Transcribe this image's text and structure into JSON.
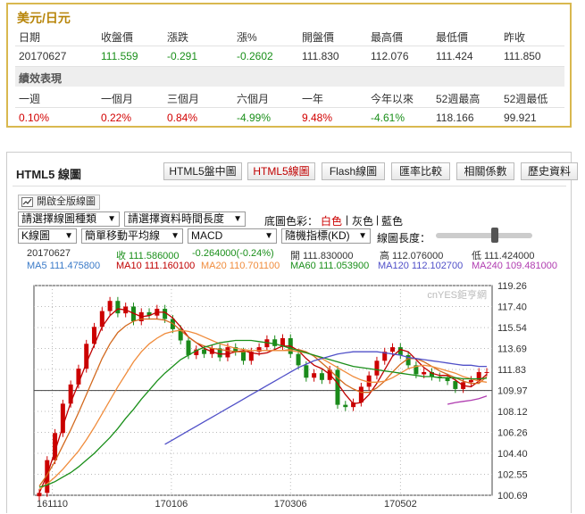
{
  "quote": {
    "title": "美元/日元",
    "headers": [
      "日期",
      "收盤價",
      "漲跌",
      "漲%",
      "開盤價",
      "最高價",
      "最低價",
      "昨收"
    ],
    "values": [
      "20170627",
      "111.559",
      "-0.291",
      "-0.2602",
      "111.830",
      "112.076",
      "111.424",
      "111.850"
    ],
    "perf_label": "績效表現",
    "perf_headers": [
      "一週",
      "一個月",
      "三個月",
      "六個月",
      "一年",
      "今年以來",
      "52週最高",
      "52週最低"
    ],
    "perf_values": [
      "0.10%",
      "0.22%",
      "0.84%",
      "-4.99%",
      "9.48%",
      "-4.61%",
      "118.166",
      "99.921"
    ]
  },
  "panel": {
    "title": "HTML5 線圖",
    "tabs": [
      "HTML5盤中圖",
      "HTML5線圖",
      "Flash線圖",
      "匯率比較",
      "相關係數",
      "歷史資料"
    ],
    "active_tab": "HTML5線圖",
    "full_version": "開啟全版線圖"
  },
  "controls": {
    "chart_type": "請選擇線圖種類",
    "time_length": "請選擇資料時間長度",
    "bg_label": "底圖色彩：",
    "bg_white": "白色",
    "bg_gray": "灰色",
    "bg_blue": "藍色",
    "divider": "|",
    "kline": "K線圖",
    "ma": "簡單移動平均線",
    "macd": "MACD",
    "kd": "隨機指標(KD)",
    "line_len": "線圖長度："
  },
  "info": {
    "date": "20170627",
    "close": "收 111.586000",
    "change": "-0.264000(-0.24%)",
    "open": "開 111.830000",
    "high": "高 112.076000",
    "low": "低 111.424000",
    "ma5": "MA5 111.475800",
    "ma10": "MA10 111.160100",
    "ma20": "MA20 110.701100",
    "ma60": "MA60 111.053900",
    "ma120": "MA120 112.102700",
    "ma240": "MA240 109.481000"
  },
  "colors": {
    "up": "#cc0000",
    "down": "#1a8a1a",
    "ma5": "#c00000",
    "ma10": "#d2691e",
    "ma20": "#f08c3c",
    "ma60": "#1a8f1a",
    "ma120": "#5050c8",
    "ma240": "#b03cb0"
  },
  "chart_data": {
    "type": "line",
    "y_ticks": [
      "119.26",
      "117.40",
      "115.54",
      "113.69",
      "111.83",
      "109.97",
      "108.12",
      "106.26",
      "104.40",
      "102.55",
      "100.69"
    ],
    "x_ticks": [
      "161110",
      "170106",
      "170306",
      "170502"
    ],
    "watermark": "cnYES鉅亨網",
    "series": [
      {
        "name": "MA5",
        "values": [
          100.9,
          102.5,
          104.6,
          106.8,
          108.9,
          110.6,
          112.4,
          114.0,
          115.6,
          116.6,
          117.2,
          117.1,
          116.8,
          116.5,
          116.6,
          116.9,
          116.9,
          116.4,
          115.6,
          114.7,
          114.2,
          113.7,
          113.4,
          113.2,
          113.2,
          113.4,
          113.5,
          113.3,
          113.2,
          113.3,
          113.6,
          113.9,
          113.9,
          113.5,
          112.8,
          112.2,
          111.9,
          111.4,
          110.6,
          109.6,
          108.8,
          108.9,
          109.6,
          110.6,
          111.8,
          113.0,
          113.6,
          113.4,
          112.7,
          112.0,
          111.5,
          111.3,
          111.3,
          110.9,
          110.4,
          110.3,
          110.8,
          111.4
        ]
      },
      {
        "name": "MA10",
        "values": [
          101.5,
          102.5,
          103.7,
          105.1,
          106.5,
          108.0,
          109.6,
          111.2,
          112.8,
          114.1,
          115.1,
          115.7,
          116.1,
          116.3,
          116.3,
          116.3,
          116.2,
          115.9,
          115.3,
          114.7,
          114.2,
          113.9,
          113.7,
          113.6,
          113.5,
          113.4,
          113.4,
          113.5,
          113.5,
          113.5,
          113.5,
          113.5,
          113.6,
          113.6,
          113.4,
          113.0,
          112.4,
          111.8,
          111.1,
          110.5,
          110.1,
          109.8,
          109.8,
          110.2,
          110.8,
          111.6,
          112.3,
          112.8,
          112.8,
          112.5,
          112.1,
          111.7,
          111.4,
          111.1,
          110.8,
          110.6,
          110.6,
          111.2
        ]
      },
      {
        "name": "MA20",
        "values": [
          101.2,
          101.7,
          102.3,
          103.0,
          103.8,
          104.6,
          105.6,
          106.7,
          107.9,
          109.1,
          110.3,
          111.4,
          112.5,
          113.4,
          114.1,
          114.6,
          115.0,
          115.2,
          115.3,
          115.2,
          115.0,
          114.7,
          114.4,
          114.1,
          113.9,
          113.7,
          113.6,
          113.5,
          113.5,
          113.5,
          113.5,
          113.5,
          113.5,
          113.4,
          113.3,
          113.1,
          112.8,
          112.4,
          112.0,
          111.6,
          111.2,
          110.9,
          110.7,
          110.7,
          110.8,
          111.1,
          111.5,
          111.9,
          112.1,
          112.2,
          112.1,
          111.9,
          111.7,
          111.5,
          111.2,
          111.0,
          110.8,
          110.7
        ]
      },
      {
        "name": "MA60",
        "values": [
          101.4,
          101.6,
          101.9,
          102.3,
          102.7,
          103.2,
          103.8,
          104.4,
          105.1,
          105.8,
          106.6,
          107.5,
          108.3,
          109.2,
          110.0,
          110.8,
          111.5,
          112.1,
          112.7,
          113.1,
          113.5,
          113.8,
          114.0,
          114.2,
          114.3,
          114.4,
          114.4,
          114.4,
          114.3,
          114.2,
          114.1,
          113.9,
          113.7,
          113.5,
          113.3,
          113.1,
          112.9,
          112.7,
          112.5,
          112.3,
          112.1,
          112.0,
          111.9,
          111.8,
          111.7,
          111.6,
          111.5,
          111.4,
          111.3,
          111.2,
          111.2,
          111.1,
          111.1,
          111.1,
          111.0,
          111.0,
          111.0,
          111.05
        ]
      },
      {
        "name": "MA120",
        "values": [
          null,
          null,
          null,
          null,
          null,
          null,
          null,
          null,
          null,
          null,
          null,
          null,
          null,
          null,
          null,
          null,
          105.2,
          105.6,
          106.0,
          106.4,
          106.8,
          107.2,
          107.6,
          108.0,
          108.4,
          108.8,
          109.2,
          109.6,
          110.0,
          110.4,
          110.8,
          111.2,
          111.6,
          112.0,
          112.3,
          112.6,
          112.8,
          113.0,
          113.2,
          113.3,
          113.4,
          113.4,
          113.4,
          113.4,
          113.3,
          113.2,
          113.1,
          112.9,
          112.8,
          112.7,
          112.6,
          112.5,
          112.4,
          112.3,
          112.2,
          112.2,
          112.1,
          112.1
        ]
      },
      {
        "name": "MA240",
        "values": [
          null,
          null,
          null,
          null,
          null,
          null,
          null,
          null,
          null,
          null,
          null,
          null,
          null,
          null,
          null,
          null,
          null,
          null,
          null,
          null,
          null,
          null,
          null,
          null,
          null,
          null,
          null,
          null,
          null,
          null,
          null,
          null,
          null,
          null,
          null,
          null,
          null,
          null,
          null,
          null,
          null,
          null,
          null,
          null,
          null,
          null,
          null,
          null,
          null,
          null,
          null,
          null,
          108.75,
          108.9,
          109.0,
          109.1,
          109.25,
          109.48
        ]
      },
      {
        "name": "Close",
        "values": [
          100.9,
          103.8,
          106.2,
          108.8,
          110.5,
          111.9,
          114.1,
          115.6,
          117.0,
          117.9,
          116.8,
          117.4,
          116.1,
          116.9,
          116.6,
          117.2,
          116.3,
          115.4,
          114.4,
          113.1,
          113.6,
          113.2,
          113.7,
          112.9,
          113.8,
          113.4,
          112.6,
          113.4,
          113.8,
          114.5,
          113.9,
          114.6,
          113.2,
          112.2,
          111.1,
          111.5,
          110.9,
          111.8,
          108.7,
          108.5,
          108.9,
          110.3,
          111.3,
          112.6,
          113.4,
          113.8,
          113.1,
          112.2,
          111.4,
          111.6,
          111.2,
          111.1,
          110.8,
          110.1,
          110.7,
          110.9,
          111.6,
          111.6
        ]
      }
    ],
    "title": "",
    "xlabel": "",
    "ylabel": "",
    "ylim": [
      100.69,
      119.26
    ],
    "grid": true
  }
}
